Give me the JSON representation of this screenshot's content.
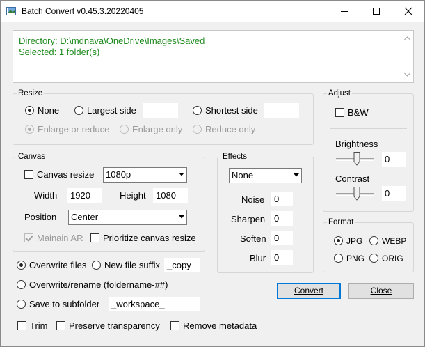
{
  "window": {
    "title": "Batch Convert v0.45.3.20220405"
  },
  "info": {
    "directory_line": "Directory: D:\\mdnava\\OneDrive\\Images\\Saved",
    "selected_line": "Selected: 1 folder(s)"
  },
  "resize": {
    "label": "Resize",
    "none": "None",
    "largest_side": "Largest side",
    "largest_side_value": "",
    "shortest_side": "Shortest side",
    "shortest_side_value": "",
    "enlarge_or_reduce": "Enlarge or reduce",
    "enlarge_only": "Enlarge only",
    "reduce_only": "Reduce only"
  },
  "canvas": {
    "label": "Canvas",
    "canvas_resize": "Canvas resize",
    "preset": "1080p",
    "width_label": "Width",
    "width_value": "1920",
    "height_label": "Height",
    "height_value": "1080",
    "position_label": "Position",
    "position_value": "Center",
    "mainain_ar": "Mainain AR",
    "prioritize": "Prioritize canvas resize"
  },
  "effects": {
    "label": "Effects",
    "selected": "None",
    "noise_label": "Noise",
    "noise_value": "0",
    "sharpen_label": "Sharpen",
    "sharpen_value": "0",
    "soften_label": "Soften",
    "soften_value": "0",
    "blur_label": "Blur",
    "blur_value": "0"
  },
  "adjust": {
    "label": "Adjust",
    "bw": "B&W",
    "brightness_label": "Brightness",
    "brightness_value": "0",
    "contrast_label": "Contrast",
    "contrast_value": "0"
  },
  "format": {
    "label": "Format",
    "jpg": "JPG",
    "webp": "WEBP",
    "png": "PNG",
    "orig": "ORIG"
  },
  "output": {
    "overwrite_files": "Overwrite files",
    "new_file_suffix": "New file suffix",
    "suffix_value": "_copy",
    "overwrite_rename": "Overwrite/rename (foldername-##)",
    "save_to_subfolder": "Save to subfolder",
    "subfolder_value": "_workspace_"
  },
  "options": {
    "trim": "Trim",
    "preserve_transparency": "Preserve transparency",
    "remove_metadata": "Remove metadata"
  },
  "buttons": {
    "convert": "Convert",
    "close": "Close"
  },
  "colors": {
    "info_text": "#1c8a1c",
    "focus_border": "#0078d7"
  }
}
